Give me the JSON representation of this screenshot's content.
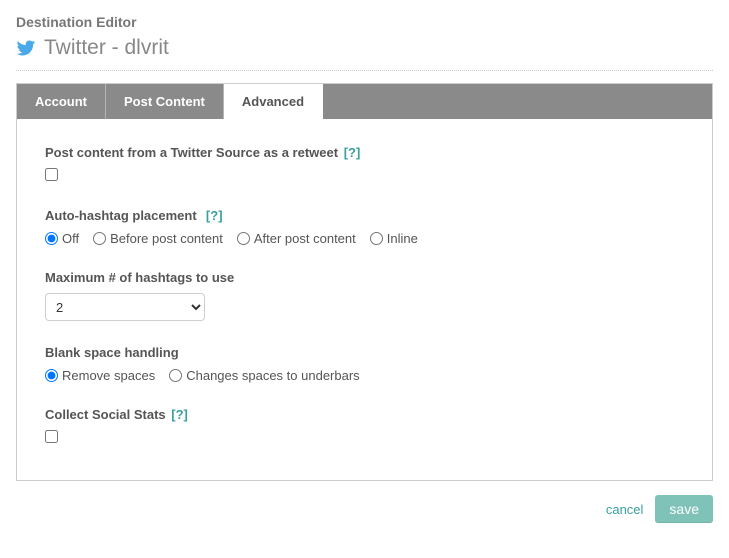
{
  "header": {
    "title": "Destination Editor",
    "subtitle": "Twitter - dlvrit",
    "icon": "twitter-icon"
  },
  "tabs": [
    {
      "label": "Account",
      "active": false
    },
    {
      "label": "Post Content",
      "active": false
    },
    {
      "label": "Advanced",
      "active": true
    }
  ],
  "sections": {
    "retweet": {
      "label": "Post content from a Twitter Source as a retweet",
      "help": "[?]",
      "checked": false
    },
    "hashtag_placement": {
      "label": "Auto-hashtag placement",
      "help": "[?]",
      "options": [
        {
          "label": "Off",
          "checked": true
        },
        {
          "label": "Before post content",
          "checked": false
        },
        {
          "label": "After post content",
          "checked": false
        },
        {
          "label": "Inline",
          "checked": false
        }
      ]
    },
    "max_hashtags": {
      "label": "Maximum # of hashtags to use",
      "value": "2"
    },
    "blank_space": {
      "label": "Blank space handling",
      "options": [
        {
          "label": "Remove spaces",
          "checked": true
        },
        {
          "label": "Changes spaces to underbars",
          "checked": false
        }
      ]
    },
    "collect_stats": {
      "label": "Collect Social Stats",
      "help": "[?]",
      "checked": false
    }
  },
  "footer": {
    "cancel": "cancel",
    "save": "save"
  }
}
